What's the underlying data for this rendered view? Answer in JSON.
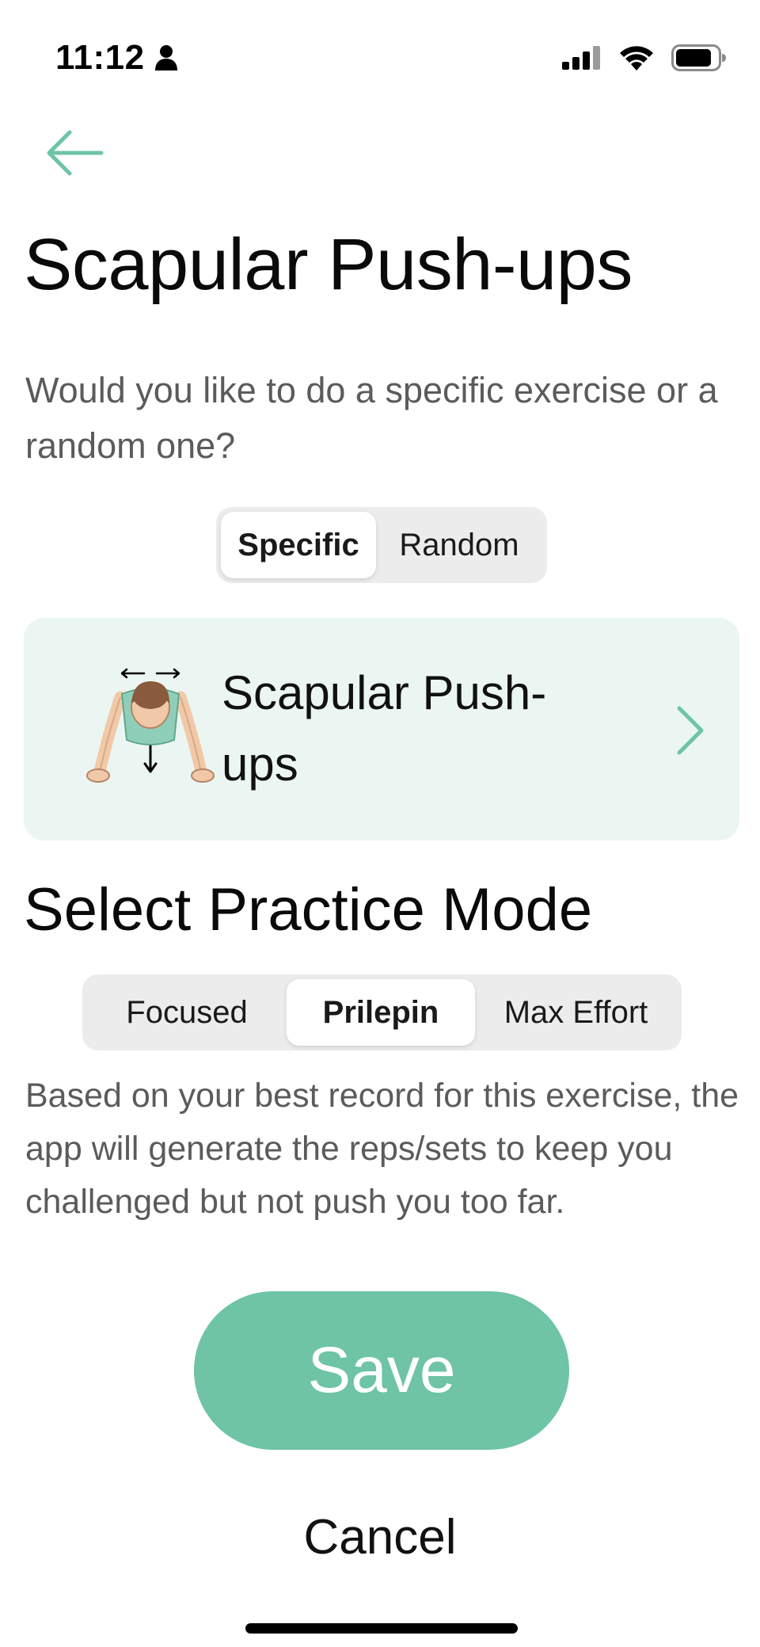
{
  "status_bar": {
    "time": "11:12",
    "icons": [
      "person-icon",
      "cellular-signal-icon",
      "wifi-icon",
      "battery-icon"
    ]
  },
  "header": {
    "back_icon": "arrow-left-icon",
    "title": "Scapular Push-ups"
  },
  "exercise_choice": {
    "question": "Would you like to do a specific exercise or a random one?",
    "options": [
      "Specific",
      "Random"
    ],
    "selected": "Specific"
  },
  "exercise_card": {
    "name": "Scapular Push-ups",
    "chevron_icon": "chevron-right-icon"
  },
  "practice_mode": {
    "heading": "Select Practice Mode",
    "options": [
      "Focused",
      "Prilepin",
      "Max Effort"
    ],
    "selected": "Prilepin",
    "description": "Based on your best record for this exercise, the app will generate the reps/sets to keep you challenged but not push you too far."
  },
  "actions": {
    "save_label": "Save",
    "cancel_label": "Cancel"
  },
  "colors": {
    "accent": "#6ec4a5",
    "card_background": "#ebf6f2",
    "segment_background": "#ececec",
    "secondary_text": "#5b5b5b"
  }
}
